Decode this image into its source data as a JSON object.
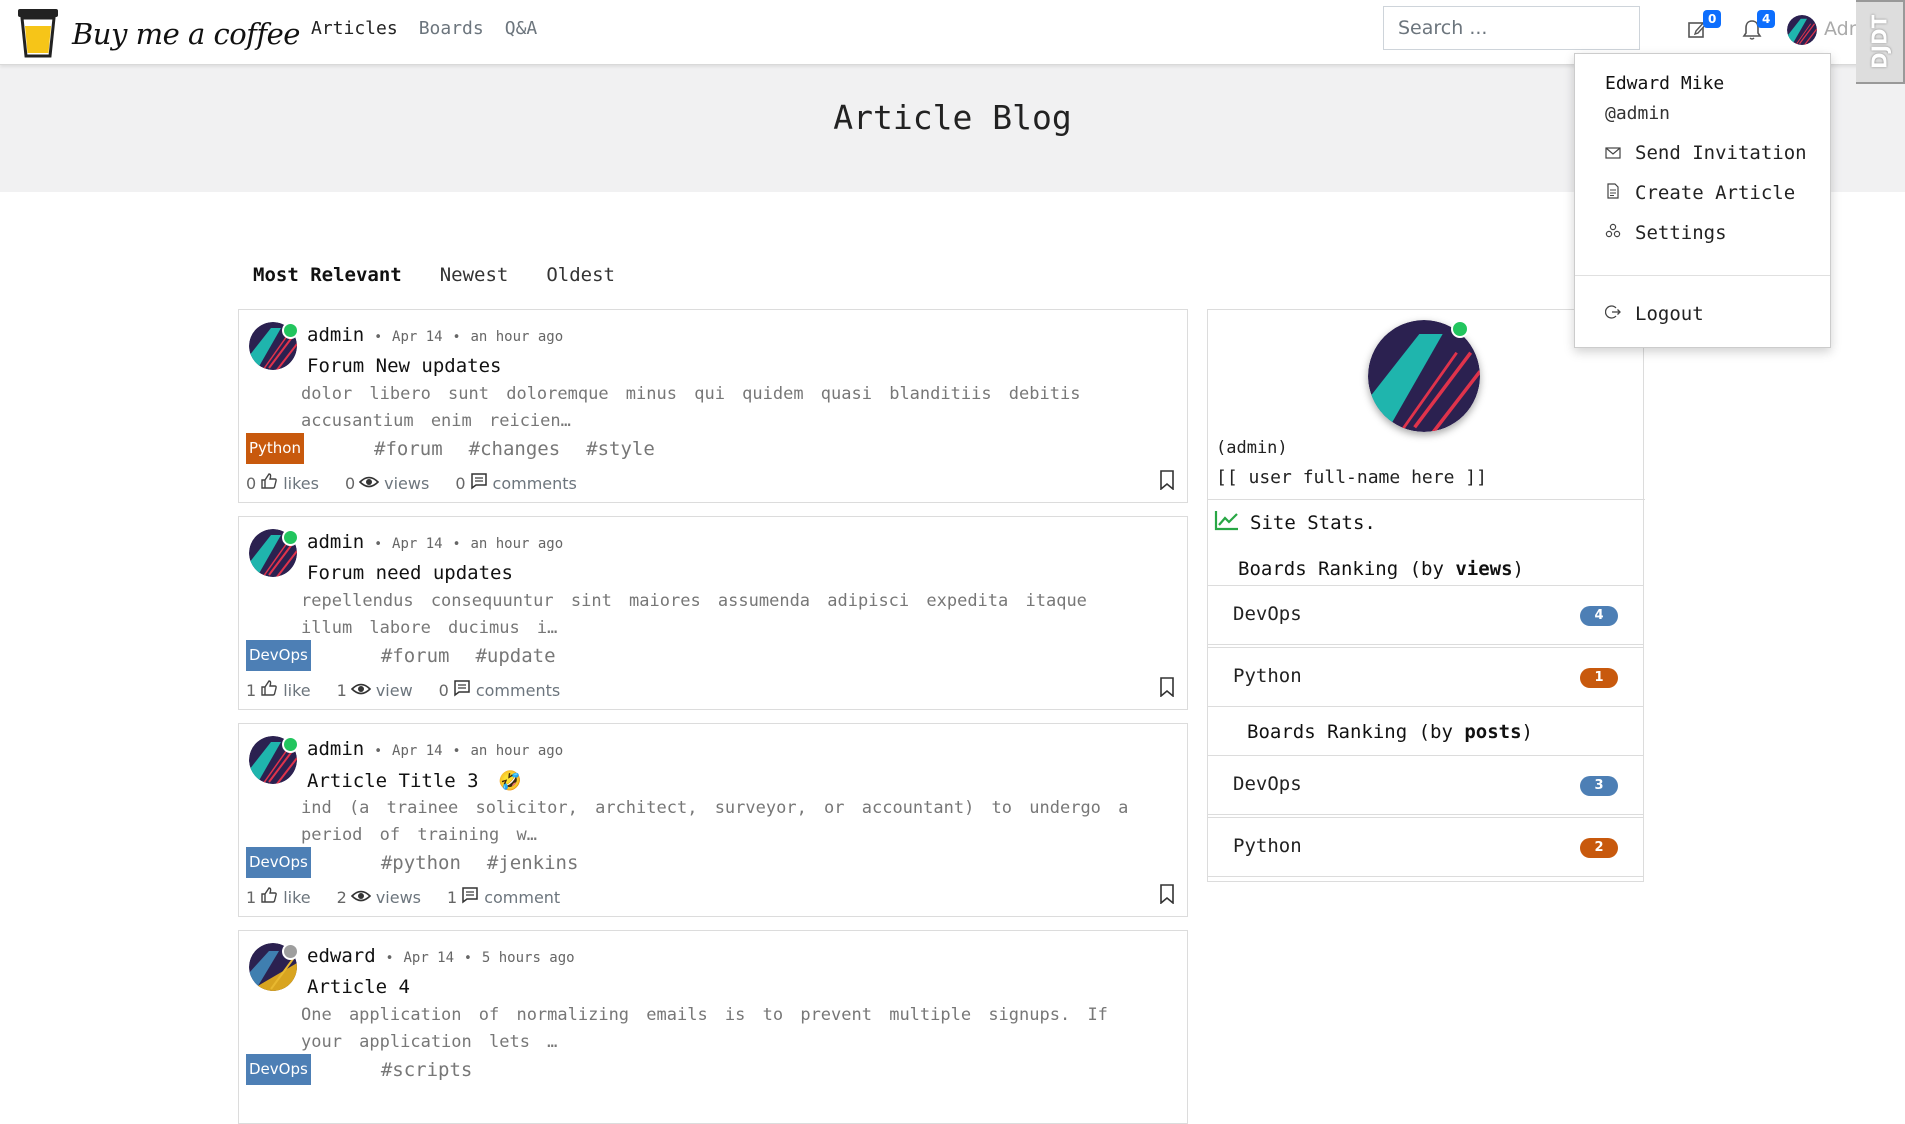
{
  "brand": {
    "name": "Buy me a coffee"
  },
  "nav": {
    "links": [
      {
        "label": "Articles",
        "active": true
      },
      {
        "label": "Boards",
        "active": false
      },
      {
        "label": "Q&A",
        "active": false
      }
    ],
    "search_placeholder": "Search ...",
    "drafts_count": "0",
    "notifications_count": "4",
    "user_label": "Admin",
    "debug_toolbar_label": "DJDT"
  },
  "hero": {
    "title": "Article Blog"
  },
  "tabs": [
    {
      "label": "Most Relevant",
      "active": true
    },
    {
      "label": "Newest",
      "active": false
    },
    {
      "label": "Oldest",
      "active": false
    }
  ],
  "posts": [
    {
      "author": "admin",
      "date": "Apr 14",
      "ago": "an hour ago",
      "online": true,
      "title": "Forum New updates",
      "emoji": "",
      "excerpt": "dolor libero sunt doloremque minus qui quidem quasi blanditiis debitis accusantium enim reicien…",
      "board": "Python",
      "board_color": "#c8590d",
      "tags": [
        "#forum",
        "#changes",
        "#style"
      ],
      "likes": "0",
      "likes_label": "likes",
      "views": "0",
      "views_label": "views",
      "comments": "0",
      "comments_label": "comments"
    },
    {
      "author": "admin",
      "date": "Apr 14",
      "ago": "an hour ago",
      "online": true,
      "title": "Forum need updates",
      "emoji": "",
      "excerpt": "repellendus consequuntur sint maiores assumenda adipisci expedita itaque illum labore ducimus i…",
      "board": "DevOps",
      "board_color": "#4d7fb5",
      "tags": [
        "#forum",
        "#update"
      ],
      "likes": "1",
      "likes_label": "like",
      "views": "1",
      "views_label": "view",
      "comments": "0",
      "comments_label": "comments"
    },
    {
      "author": "admin",
      "date": "Apr 14",
      "ago": "an hour ago",
      "online": true,
      "title": "Article Title 3",
      "emoji": "🤣",
      "excerpt": "ind (a trainee solicitor, architect, surveyor, or accountant) to undergo a period of training w…",
      "board": "DevOps",
      "board_color": "#4d7fb5",
      "tags": [
        "#python",
        "#jenkins"
      ],
      "likes": "1",
      "likes_label": "like",
      "views": "2",
      "views_label": "views",
      "comments": "1",
      "comments_label": "comment"
    },
    {
      "author": "edward",
      "date": "Apr 14",
      "ago": "5 hours ago",
      "online": false,
      "title": "Article 4",
      "emoji": "",
      "excerpt": "One application of normalizing emails is to prevent multiple signups. If your application lets …",
      "board": "DevOps",
      "board_color": "#4d7fb5",
      "tags": [
        "#scripts"
      ],
      "likes": "",
      "likes_label": "",
      "views": "",
      "views_label": "",
      "comments": "",
      "comments_label": ""
    }
  ],
  "sidebar": {
    "username": "(admin)",
    "fullname": "[[ user full-name here ]]",
    "stats_label": "Site Stats.",
    "views_heading_prefix": "Boards Ranking (by ",
    "views_heading_bold": "views",
    "views_heading_suffix": ")",
    "views_ranking": [
      {
        "name": "DevOps",
        "count": "4",
        "color": "#4d7fb5"
      },
      {
        "name": "Python",
        "count": "1",
        "color": "#c8590d"
      }
    ],
    "posts_heading_prefix": "Boards Ranking (by ",
    "posts_heading_bold": "posts",
    "posts_heading_suffix": ")",
    "posts_ranking": [
      {
        "name": "DevOps",
        "count": "3",
        "color": "#4d7fb5"
      },
      {
        "name": "Python",
        "count": "2",
        "color": "#c8590d"
      }
    ]
  },
  "user_menu": {
    "name": "Edward Mike",
    "handle": "@admin",
    "items": [
      {
        "label": "Send Invitation",
        "icon": "envelope-icon"
      },
      {
        "label": "Create Article",
        "icon": "document-icon"
      },
      {
        "label": "Settings",
        "icon": "settings-icon"
      }
    ],
    "logout_label": "Logout"
  },
  "colors": {
    "python": "#c8590d",
    "devops": "#4d7fb5",
    "online": "#22c55e",
    "badge_blue": "#0d6efd",
    "stats_green": "#28a745"
  }
}
